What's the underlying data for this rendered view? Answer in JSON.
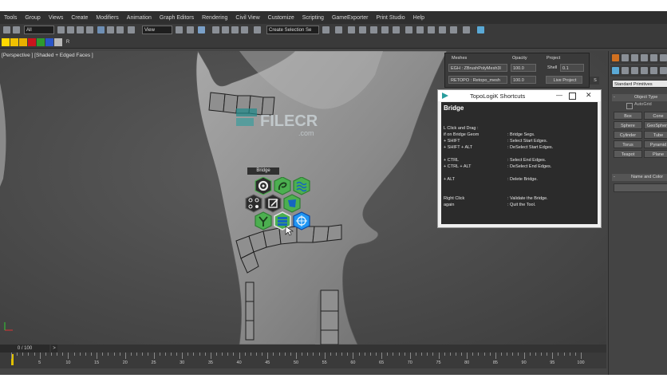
{
  "menu": [
    "Tools",
    "Group",
    "Views",
    "Create",
    "Modifiers",
    "Animation",
    "Graph Editors",
    "Rendering",
    "Civil View",
    "Customize",
    "Scripting",
    "GameExporter",
    "Print Studio",
    "Help"
  ],
  "toolbar": {
    "selection_filter": "All",
    "reference_coord": "View",
    "named_selection": "Create Selection Se"
  },
  "viewport": {
    "label": "[Perspective ] [Shaded + Edged Faces ]"
  },
  "watermark": {
    "text": "FILECR",
    "suffix": ".com"
  },
  "hex_menu": {
    "tooltip": "Bridge",
    "icons": [
      "gear-icon",
      "lasso-icon",
      "wave-icon",
      "vertices-icon",
      "edit-icon",
      "patch-icon",
      "branch-icon",
      "bridge-icon",
      "relax-icon"
    ]
  },
  "meshes_panel": {
    "meshes_label": "Meshes",
    "opacity_label": "Opacity",
    "project_label": "Project",
    "mesh1": "EGH : ZBrushPolyMesh3I",
    "mesh2": "RETOPO : Retopo_mesh",
    "opacity1": "100.0",
    "opacity2": "100.0",
    "shell_label": "Shell",
    "shell_value": "0.1",
    "live_project": "Live Project",
    "s_button": "S"
  },
  "shortcuts": {
    "title": "TopoLogiK Shortcuts",
    "heading": "Bridge",
    "rows": [
      {
        "key": "L Click and Drag   :",
        "desc": ""
      },
      {
        "key": "    if on Bridge Geom",
        "desc": ": Bridge Segs."
      },
      {
        "key": "    + SHIFT",
        "desc": ": Select Start Edges."
      },
      {
        "key": "    + SHIFT + ALT",
        "desc": ": DeSelect Start Edges."
      },
      {
        "key": "    + CTRL",
        "desc": ": Select End Edges."
      },
      {
        "key": "    + CTRL + ALT",
        "desc": ": DeSelect End Edges."
      },
      {
        "key": "    + ALT",
        "desc": ": Delete Bridge."
      },
      {
        "key": "Right Click",
        "desc": ": Validate the Bridge."
      },
      {
        "key": "    again",
        "desc": ": Quit the Tool."
      }
    ]
  },
  "right_panel": {
    "category": "Standard Primitives",
    "object_type_label": "Object Type",
    "autogrid": "AutoGrid",
    "buttons": [
      "Box",
      "Cone",
      "Sphere",
      "GeoSphere",
      "Cylinder",
      "Tube",
      "Torus",
      "Pyramid",
      "Teapot",
      "Plane"
    ],
    "name_color_label": "Name and Color"
  },
  "timeline": {
    "frame_counter": "0 / 100",
    "next_arrow": ">",
    "ticks": [
      "5",
      "10",
      "15",
      "20",
      "25",
      "30",
      "35",
      "40",
      "45",
      "50",
      "55",
      "60",
      "65",
      "70",
      "75",
      "80",
      "85",
      "90",
      "95",
      "100"
    ]
  },
  "colors": {
    "menubar": "#2f2f2f",
    "viewport_bg": "#4b4b4b",
    "hex_green": "#4caf50",
    "hex_dark": "#2c2c2c",
    "hex_blue": "#2196f3"
  }
}
